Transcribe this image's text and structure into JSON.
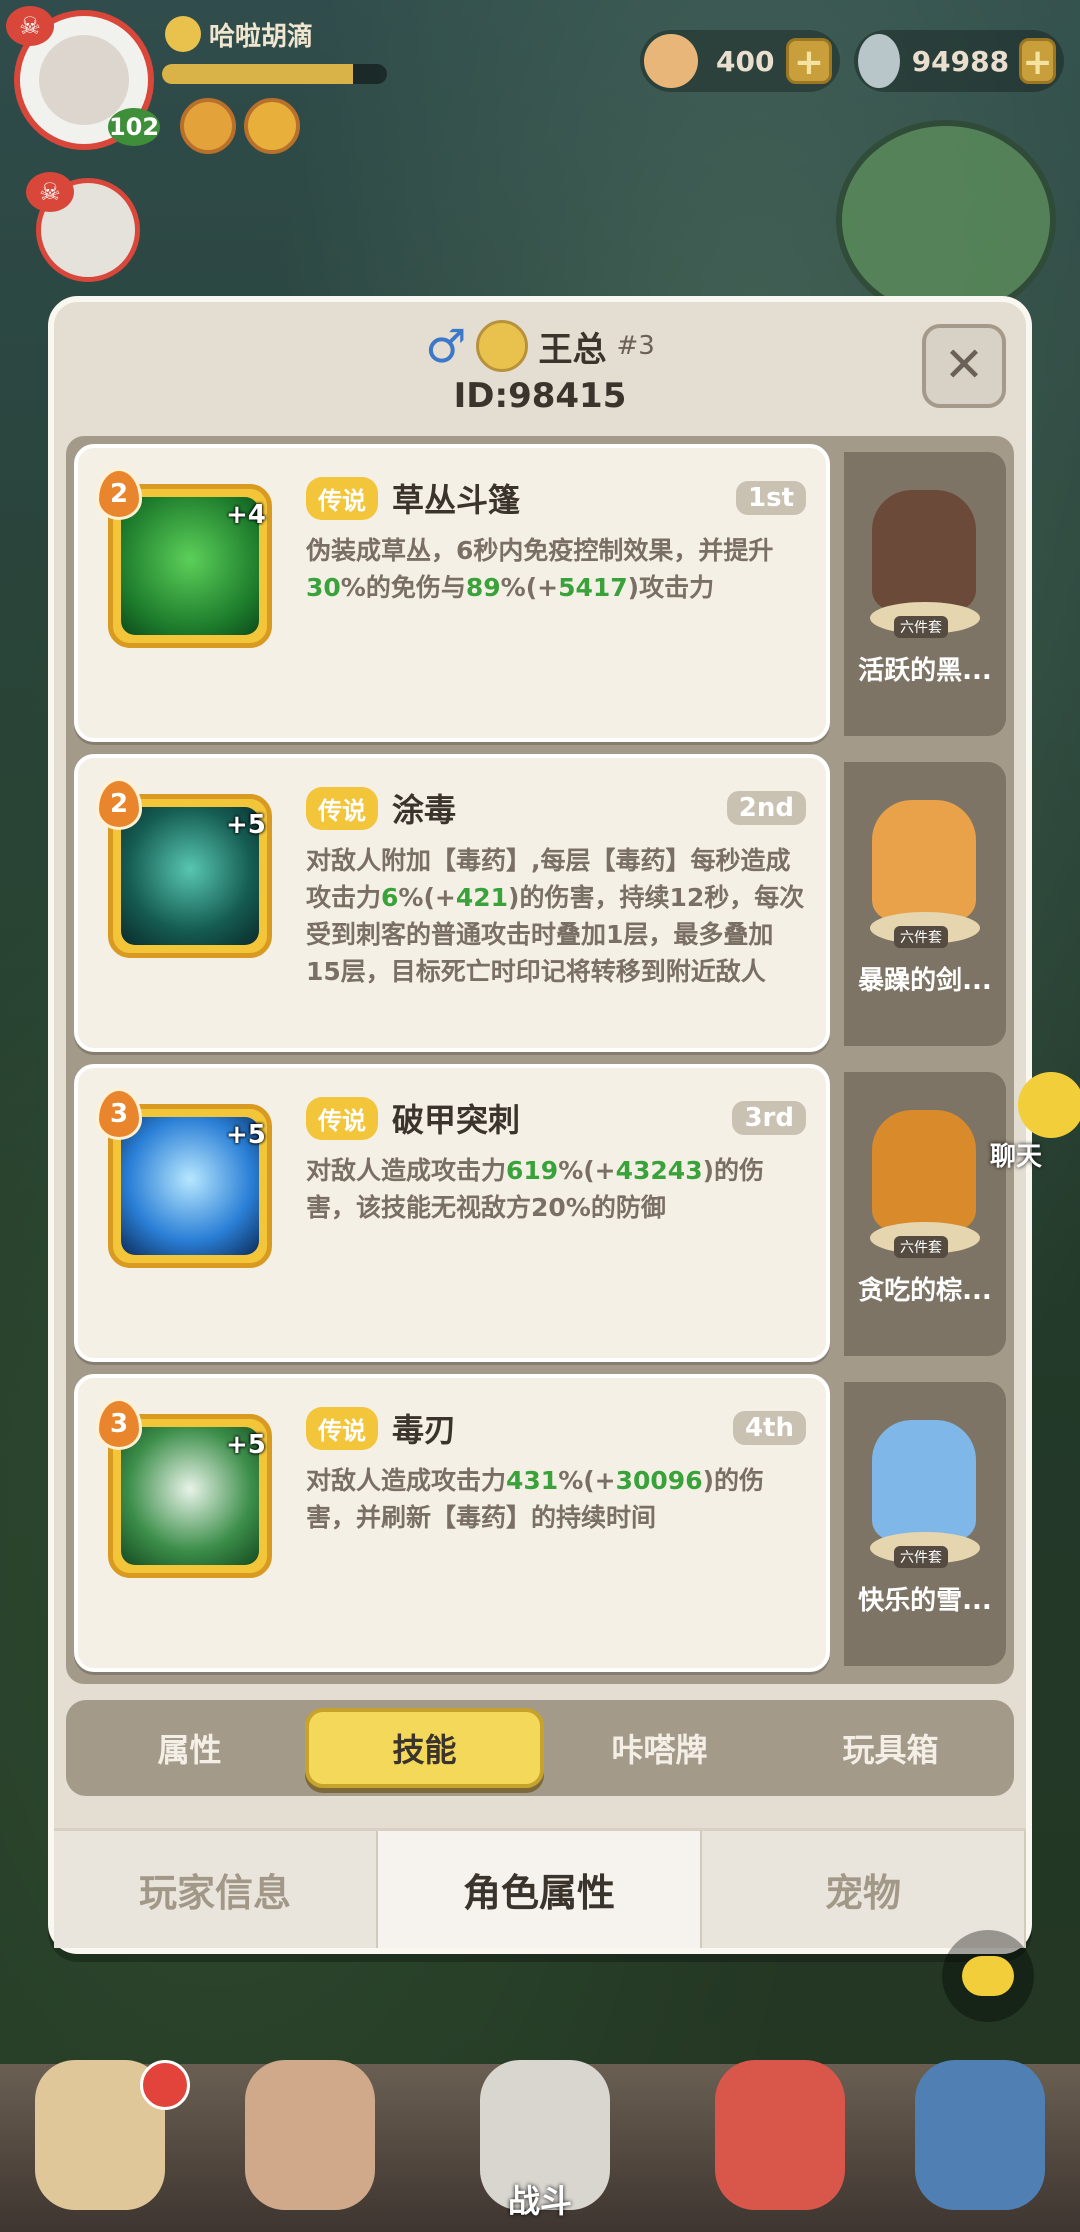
{
  "player": {
    "name": "哈啦胡滴",
    "level": "102",
    "exp_fraction": 0.85
  },
  "currency": {
    "shells": "400",
    "gems": "94988"
  },
  "chat_side_label": "聊天",
  "profile": {
    "gender_icon": "male-symbol-icon",
    "name": "王总",
    "tag": "#3",
    "id_text": "ID:98415"
  },
  "skills": [
    {
      "level": "2",
      "plus": "+4",
      "rarity": "传说",
      "name": "草丛斗篷",
      "rank": "1st",
      "icon": "bush-cloak-icon",
      "desc_parts": [
        {
          "t": "伪装成草丛，6秒内免疫控制效果，并提升"
        },
        {
          "t": "30",
          "g": true
        },
        {
          "t": "%的免伤与"
        },
        {
          "t": "89",
          "g": true
        },
        {
          "t": "%(+"
        },
        {
          "t": "5417",
          "g": true
        },
        {
          "t": ")攻击力"
        }
      ],
      "set_name": "活跃的黑...",
      "set_tag": "六件套"
    },
    {
      "level": "2",
      "plus": "+5",
      "rarity": "传说",
      "name": "涂毒",
      "rank": "2nd",
      "icon": "poison-drop-icon",
      "desc_parts": [
        {
          "t": "对敌人附加【毒药】,每层【毒药】每秒造成攻击力"
        },
        {
          "t": "6",
          "g": true
        },
        {
          "t": "%(+"
        },
        {
          "t": "421",
          "g": true
        },
        {
          "t": ")的伤害，持续12秒，每次受到刺客的普通攻击时叠加1层，最多叠加15层，目标死亡时印记将转移到附近敌人"
        }
      ],
      "set_name": "暴躁的剑...",
      "set_tag": "六件套"
    },
    {
      "level": "3",
      "plus": "+5",
      "rarity": "传说",
      "name": "破甲突刺",
      "rank": "3rd",
      "icon": "armor-pierce-icon",
      "desc_parts": [
        {
          "t": "对敌人造成攻击力"
        },
        {
          "t": "619",
          "g": true
        },
        {
          "t": "%(+"
        },
        {
          "t": "43243",
          "g": true
        },
        {
          "t": ")的伤害，该技能无视敌方20%的防御"
        }
      ],
      "set_name": "贪吃的棕...",
      "set_tag": "六件套"
    },
    {
      "level": "3",
      "plus": "+5",
      "rarity": "传说",
      "name": "毒刃",
      "rank": "4th",
      "icon": "poison-skull-icon",
      "desc_parts": [
        {
          "t": "对敌人造成攻击力"
        },
        {
          "t": "431",
          "g": true
        },
        {
          "t": "%(+"
        },
        {
          "t": "30096",
          "g": true
        },
        {
          "t": ")的伤害，并刷新【毒药】的持续时间"
        }
      ],
      "set_name": "快乐的雪...",
      "set_tag": "六件套"
    }
  ],
  "subtabs": [
    "属性",
    "技能",
    "咔嗒牌",
    "玩具箱"
  ],
  "subtab_active": 1,
  "maintabs": [
    "玩家信息",
    "角色属性",
    "宠物"
  ],
  "maintab_active": 1,
  "bottom_nav": {
    "center_label": "战斗"
  },
  "colors": {
    "accent_yellow": "#f3d85a",
    "value_green": "#3aa23a",
    "rank_gray": "#c9c1b2"
  }
}
